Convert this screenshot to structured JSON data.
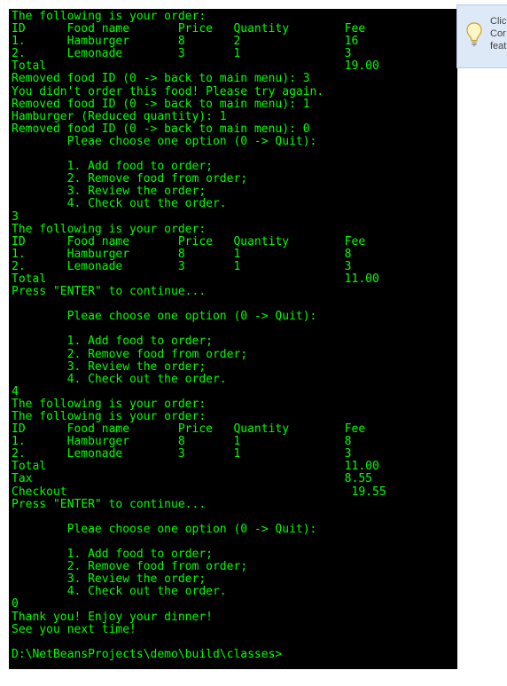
{
  "console": {
    "lines": [
      "The following is your order:",
      "ID      Food name       Price   Quantity        Fee",
      "1.      Hamburger       8       2               16",
      "2.      Lemonade        3       1               3",
      "Total                                           19.00",
      "Removed food ID (0 -> back to main menu): 3",
      "You didn't order this food! Please try again.",
      "Removed food ID (0 -> back to main menu): 1",
      "Hamburger (Reduced quantity): 1",
      "Removed food ID (0 -> back to main menu): 0",
      "        Pleae choose one option (0 -> Quit):",
      "",
      "        1. Add food to order;",
      "        2. Remove food from order;",
      "        3. Review the order;",
      "        4. Check out the order.",
      "3",
      "The following is your order:",
      "ID      Food name       Price   Quantity        Fee",
      "1.      Hamburger       8       1               8",
      "2.      Lemonade        3       1               3",
      "Total                                           11.00",
      "Press \"ENTER\" to continue...",
      "",
      "        Pleae choose one option (0 -> Quit):",
      "",
      "        1. Add food to order;",
      "        2. Remove food from order;",
      "        3. Review the order;",
      "        4. Check out the order.",
      "4",
      "The following is your order:",
      "The following is your order:",
      "ID      Food name       Price   Quantity        Fee",
      "1.      Hamburger       8       1               8",
      "2.      Lemonade        3       1               3",
      "Total                                           11.00",
      "Tax                                             8.55",
      "Checkout                                         19.55",
      "Press \"ENTER\" to continue...",
      "",
      "        Pleae choose one option (0 -> Quit):",
      "",
      "        1. Add food to order;",
      "        2. Remove food from order;",
      "        3. Review the order;",
      "        4. Check out the order.",
      "0",
      "Thank you! Enjoy your dinner!",
      "See you next time!",
      "",
      "D:\\NetBeansProjects\\demo\\build\\classes>"
    ]
  },
  "tip": {
    "icon": "lightbulb-icon",
    "text_line1": "Clic",
    "text_line2": "Cor",
    "text_line3": "feat"
  },
  "colors": {
    "console_background": "#000000",
    "console_text": "#00ff00",
    "tip_background": "#dde9f7"
  }
}
